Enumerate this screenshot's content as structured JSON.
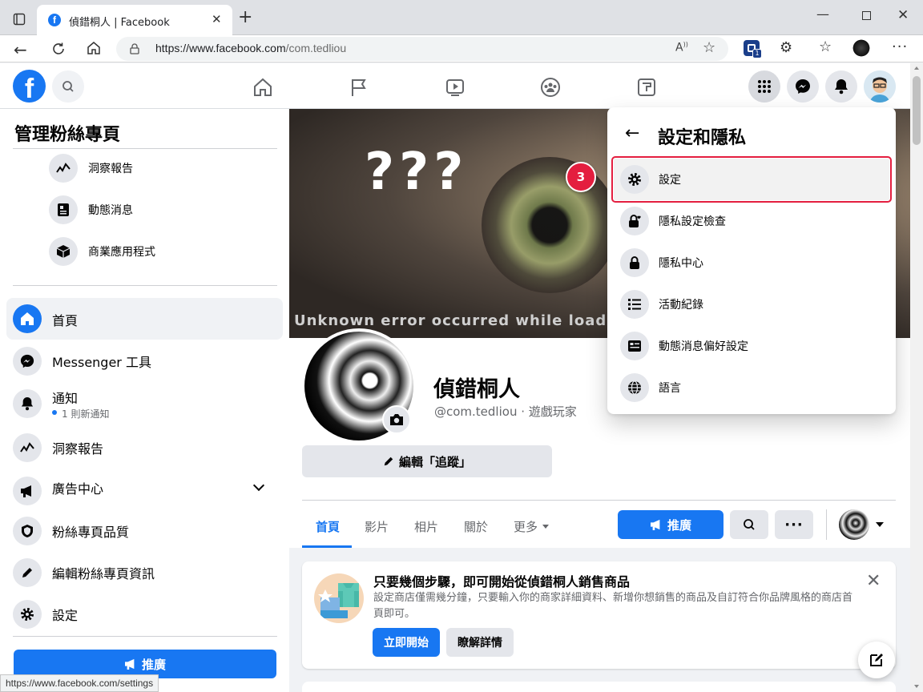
{
  "browser": {
    "tab_title": "偵錯桐人 | Facebook",
    "url_host": "https://www.facebook.com",
    "url_path": "/com.tedliou",
    "status_url": "https://www.facebook.com/settings",
    "ext_badge": "1"
  },
  "sidebar": {
    "title": "管理粉絲專頁",
    "sub_items": [
      {
        "label": "洞察報告",
        "icon": "insights-icon"
      },
      {
        "label": "動態消息",
        "icon": "news-feed-icon"
      },
      {
        "label": "商業應用程式",
        "icon": "box-icon"
      }
    ],
    "items": [
      {
        "label": "首頁",
        "icon": "home-icon"
      },
      {
        "label": "Messenger 工具",
        "icon": "messenger-icon"
      },
      {
        "label": "通知",
        "icon": "bell-icon",
        "sub": "1 則新通知"
      },
      {
        "label": "洞察報告",
        "icon": "insights-icon"
      },
      {
        "label": "廣告中心",
        "icon": "megaphone-icon"
      },
      {
        "label": "粉絲專頁品質",
        "icon": "shield-icon"
      },
      {
        "label": "編輯粉絲專頁資訊",
        "icon": "pencil-icon"
      },
      {
        "label": "設定",
        "icon": "gear-icon"
      }
    ],
    "promote_label": "推廣"
  },
  "cover": {
    "overlay_text": "???",
    "error_text": "Unknown error occurred while loading 'Asse"
  },
  "profile": {
    "name": "偵錯桐人",
    "handle": "@com.tedliou · 遊戲玩家",
    "edit_button": "編輯「追蹤」"
  },
  "page_tabs": [
    "首頁",
    "影片",
    "相片",
    "關於",
    "更多"
  ],
  "page_actions": {
    "promote": "推廣"
  },
  "dropdown": {
    "title": "設定和隱私",
    "step_badge": "3",
    "items": [
      {
        "label": "設定",
        "icon": "gear-icon"
      },
      {
        "label": "隱私設定檢查",
        "icon": "lock-heart-icon"
      },
      {
        "label": "隱私中心",
        "icon": "lock-icon"
      },
      {
        "label": "活動紀錄",
        "icon": "list-icon"
      },
      {
        "label": "動態消息偏好設定",
        "icon": "news-feed-icon"
      },
      {
        "label": "語言",
        "icon": "globe-icon"
      }
    ]
  },
  "shop_card": {
    "title": "只要幾個步驟，即可開始從偵錯桐人銷售商品",
    "body": "設定商店僅需幾分鐘，只要輸入你的商家詳細資料、新增你想銷售的商品及自訂符合你品牌風格的商店首頁即可。",
    "primary": "立即開始",
    "secondary": "瞭解詳情"
  },
  "colors": {
    "fb_blue": "#1877f2",
    "highlight_red": "#e41e3f"
  }
}
